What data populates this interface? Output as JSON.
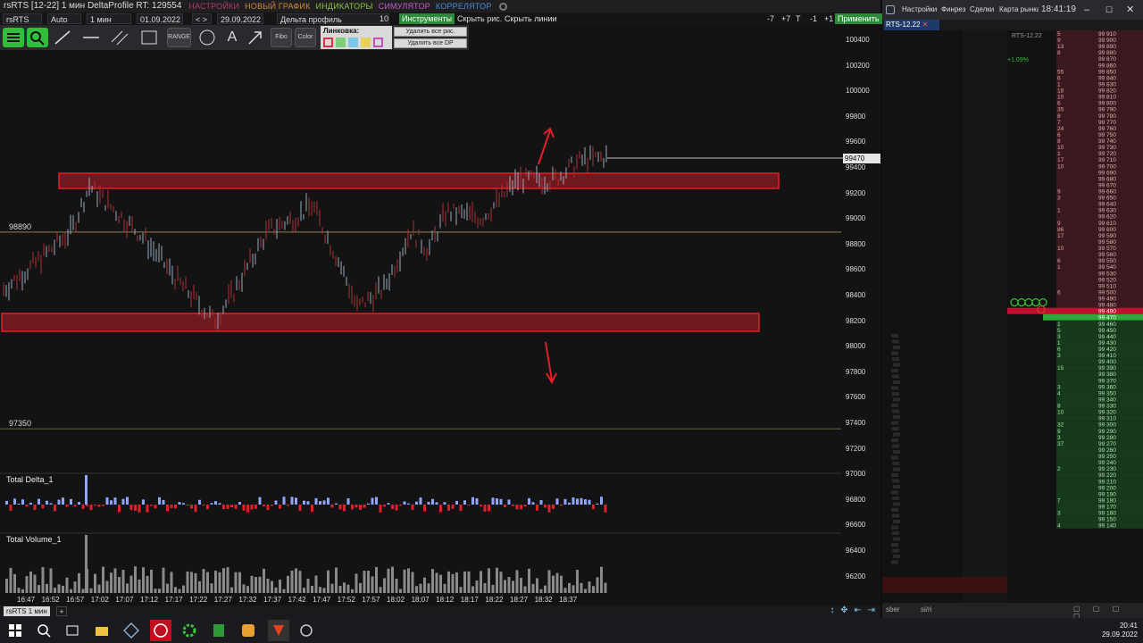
{
  "window": {
    "title": "rsRTS [12-22] 1 мин DeltaProfile RT: 129554",
    "menu": [
      {
        "label": "НАСТРОЙКИ",
        "color": "#b03a6a"
      },
      {
        "label": "НОВЫЙ ГРАФИК",
        "color": "#d08a3a"
      },
      {
        "label": "ИНДИКАТОРЫ",
        "color": "#8ac33a"
      },
      {
        "label": "СИМУЛЯТОР",
        "color": "#c85ac8"
      },
      {
        "label": "КОРРЕЛЯТОР",
        "color": "#4a8ad0"
      }
    ]
  },
  "toolbar": {
    "symbol": "rsRTS",
    "mode": "Auto",
    "timeframe": "1 мин",
    "date_from": "01.09.2022",
    "nav": "< >",
    "date_to": "29.09.2022",
    "profile": "Дельта профиль",
    "profile_count": "10",
    "instruments": "Инструменты",
    "hide_drawings": "Скрыть рис.",
    "hide_lines": "Скрыть линии",
    "steps": [
      "-7",
      "+7",
      "T",
      "-1",
      "+1"
    ],
    "apply": "Применить"
  },
  "drawing_tools": {
    "range": "RANGE",
    "fibo": "Fibo",
    "color": "Color",
    "link_label": "Линковка:",
    "delete_all_drawings": "Удалить все рис.",
    "delete_all_dp": "Удалить все DP"
  },
  "chart": {
    "price_ticks": [
      "100400",
      "100200",
      "100000",
      "99800",
      "99600",
      "99400",
      "99200",
      "99000",
      "98800",
      "98600",
      "98400",
      "98200",
      "98000",
      "97800",
      "97600",
      "97400",
      "97200",
      "97000",
      "96800",
      "96600",
      "96400",
      "96200"
    ],
    "current_price": "99470",
    "level_high": "98890",
    "level_low": "97350",
    "time_ticks": [
      "16:47",
      "16:52",
      "16:57",
      "17:02",
      "17:07",
      "17:12",
      "17:17",
      "17:22",
      "17:27",
      "17:32",
      "17:37",
      "17:42",
      "17:47",
      "17:52",
      "17:57",
      "18:02",
      "18:07",
      "18:12",
      "18:17",
      "18:22",
      "18:27",
      "18:32",
      "18:37"
    ],
    "delta_panel": "Total Delta_1",
    "volume_panel": "Total Volume_1",
    "colors": {
      "zone": "#e0202a",
      "up": "#8fa6ff",
      "down": "#e0202a",
      "level": "#c8b070"
    }
  },
  "bottom_tab": {
    "label": "rsRTS 1 мин",
    "plus": "+"
  },
  "dom": {
    "menu": [
      "Настройки",
      "Финрез",
      "Сделки",
      "Карта рынка"
    ],
    "time": "18:41:19",
    "tab": "RTS-12.22",
    "label_small": "RTS-12.22",
    "pct": "+1.09%",
    "ask_prices": [
      "99 910",
      "99 900",
      "99 890",
      "99 880",
      "99 870",
      "99 860",
      "99 850",
      "99 840",
      "99 830",
      "99 820",
      "99 810",
      "99 800",
      "99 790",
      "99 780",
      "99 770",
      "99 760",
      "99 750",
      "99 740",
      "99 730",
      "99 720",
      "99 710",
      "99 700",
      "99 690",
      "99 680",
      "99 670",
      "99 660",
      "99 650",
      "99 640",
      "99 630",
      "99 620",
      "99 610",
      "99 600",
      "99 590",
      "99 580",
      "99 570",
      "99 560",
      "99 550",
      "99 540",
      "99 530",
      "99 520",
      "99 510",
      "99 500",
      "99 490",
      "99 480"
    ],
    "ask_volumes": [
      "5",
      "9",
      "13",
      "8",
      "",
      "",
      "55",
      "6",
      "1",
      "18",
      "10",
      "6",
      "35",
      "8",
      "7",
      "24",
      "6",
      "8",
      "10",
      "1",
      "17",
      "10",
      "",
      "",
      "",
      "9",
      "3",
      "",
      "1",
      "",
      "9",
      "86",
      "17",
      "",
      "10",
      "",
      "6",
      "1",
      "",
      "",
      "",
      "6",
      "",
      ""
    ],
    "best_ask": "99 490",
    "best_bid": "99 470",
    "bid_prices": [
      "99 460",
      "99 450",
      "99 440",
      "99 430",
      "99 420",
      "99 410",
      "99 400",
      "99 390",
      "99 380",
      "99 370",
      "99 360",
      "99 350",
      "99 340",
      "99 330",
      "99 320",
      "99 310",
      "99 300",
      "99 290",
      "99 280",
      "99 270",
      "99 260",
      "99 250",
      "99 240",
      "99 230",
      "99 220",
      "99 210",
      "99 200",
      "99 190",
      "99 180",
      "99 170",
      "99 160",
      "99 150",
      "99 140"
    ],
    "bid_volumes": [
      "1",
      "5",
      "3",
      "1",
      "6",
      "3",
      "",
      "15",
      "",
      "",
      "3",
      "4",
      "",
      "8",
      "10",
      "",
      "32",
      "9",
      "3",
      "37",
      "",
      "",
      "",
      "2",
      "",
      "",
      "",
      "",
      "7",
      "",
      "3",
      "",
      "4"
    ],
    "bottom_tabs": [
      "sber",
      "si/ri"
    ]
  },
  "taskbar": {
    "time": "20:41",
    "date": "29.09.2022"
  }
}
